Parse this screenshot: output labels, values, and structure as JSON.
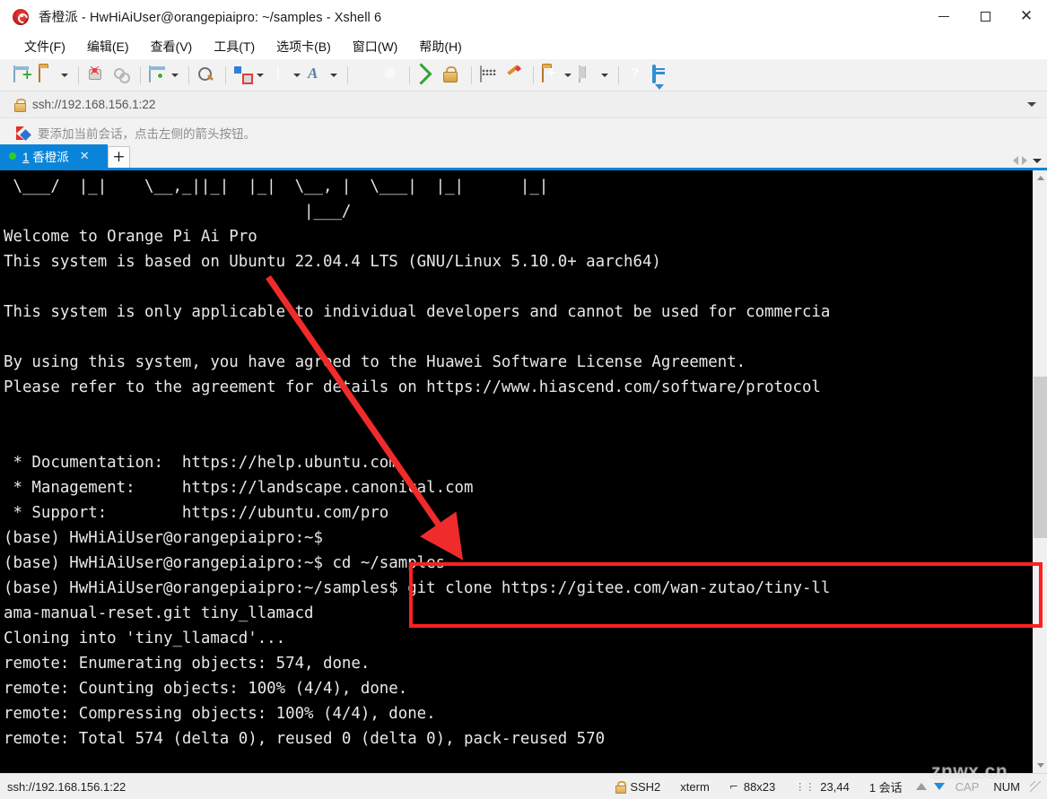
{
  "window": {
    "title": "香橙派 - HwHiAiUser@orangepiaipro: ~/samples - Xshell 6",
    "minimize_label": "",
    "maximize_label": "",
    "close_label": "✕"
  },
  "menubar": {
    "items": [
      {
        "label": "文件(F)"
      },
      {
        "label": "编辑(E)"
      },
      {
        "label": "查看(V)"
      },
      {
        "label": "工具(T)"
      },
      {
        "label": "选项卡(B)"
      },
      {
        "label": "窗口(W)"
      },
      {
        "label": "帮助(H)"
      }
    ]
  },
  "toolbar": {
    "items": [
      {
        "icon": "new-file-icon",
        "dropdown": false
      },
      {
        "icon": "open-folder-icon",
        "dropdown": true
      },
      {
        "icon": "connect-icon",
        "dropdown": false
      },
      {
        "icon": "disconnect-icon",
        "dropdown": false
      },
      {
        "icon": "session-properties-icon",
        "dropdown": true
      },
      {
        "icon": "find-icon",
        "dropdown": false
      },
      {
        "icon": "file-transfer-icon",
        "dropdown": true
      },
      {
        "icon": "globe-icon",
        "dropdown": true
      },
      {
        "icon": "font-icon",
        "dropdown": true
      },
      {
        "icon": "xshell-swirl-icon",
        "dropdown": false
      },
      {
        "icon": "xftp-icon",
        "dropdown": false
      },
      {
        "icon": "fullscreen-icon",
        "dropdown": false
      },
      {
        "icon": "lock-icon",
        "dropdown": false
      },
      {
        "icon": "keyboard-icon",
        "dropdown": false
      },
      {
        "icon": "highlight-pen-icon",
        "dropdown": false
      },
      {
        "icon": "add-folder-icon",
        "dropdown": true
      },
      {
        "icon": "layout-icon",
        "dropdown": true
      },
      {
        "icon": "help-icon",
        "dropdown": false
      },
      {
        "icon": "chat-icon",
        "dropdown": false
      }
    ]
  },
  "address_bar": {
    "icon": "lock-icon",
    "value": "ssh://192.168.156.1:22",
    "placeholder": "ssh://192.168.156.1:22",
    "dropdown_icon": "chevron-down-icon"
  },
  "notice_bar": {
    "icon": "red-flag-icon",
    "text": "要添加当前会话，点击左侧的箭头按钮。"
  },
  "tabbar": {
    "tabs": [
      {
        "index": "1",
        "label": "香橙派",
        "close_label": "✕",
        "active": true
      }
    ],
    "new_tab_label": "+",
    "nav": {
      "prev": "prev-tab-icon",
      "next": "next-tab-icon",
      "list": "tab-list-icon"
    }
  },
  "terminal": {
    "lines": [
      " \\___/  |_|    \\__,_||_|  |_|  \\__, |  \\___|  |_|      |_|",
      "                                |___/",
      "Welcome to Orange Pi Ai Pro",
      "This system is based on Ubuntu 22.04.4 LTS (GNU/Linux 5.10.0+ aarch64)",
      "",
      "This system is only applicable to individual developers and cannot be used for commercia",
      "",
      "By using this system, you have agreed to the Huawei Software License Agreement.",
      "Please refer to the agreement for details on https://www.hiascend.com/software/protocol",
      "",
      "",
      " * Documentation:  https://help.ubuntu.com",
      " * Management:     https://landscape.canonical.com",
      " * Support:        https://ubuntu.com/pro",
      "(base) HwHiAiUser@orangepiaipro:~$",
      "(base) HwHiAiUser@orangepiaipro:~$ cd ~/samples",
      "(base) HwHiAiUser@orangepiaipro:~/samples$ git clone https://gitee.com/wan-zutao/tiny-ll",
      "ama-manual-reset.git tiny_llamacd",
      "Cloning into 'tiny_llamacd'...",
      "remote: Enumerating objects: 574, done.",
      "remote: Counting objects: 100% (4/4), done.",
      "remote: Compressing objects: 100% (4/4), done.",
      "remote: Total 574 (delta 0), reused 0 (delta 0), pack-reused 570"
    ],
    "highlight_box_color": "#fd2020",
    "arrow_color": "#ef2b2b"
  },
  "statusbar": {
    "connection": "ssh://192.168.156.1:22",
    "protocol": "SSH2",
    "terminal_type": "xterm",
    "size": "88x23",
    "cursor": "23,44",
    "sessions": "1 会话",
    "cap": "CAP",
    "num": "NUM"
  },
  "watermark": {
    "text": "znwx.cn"
  }
}
